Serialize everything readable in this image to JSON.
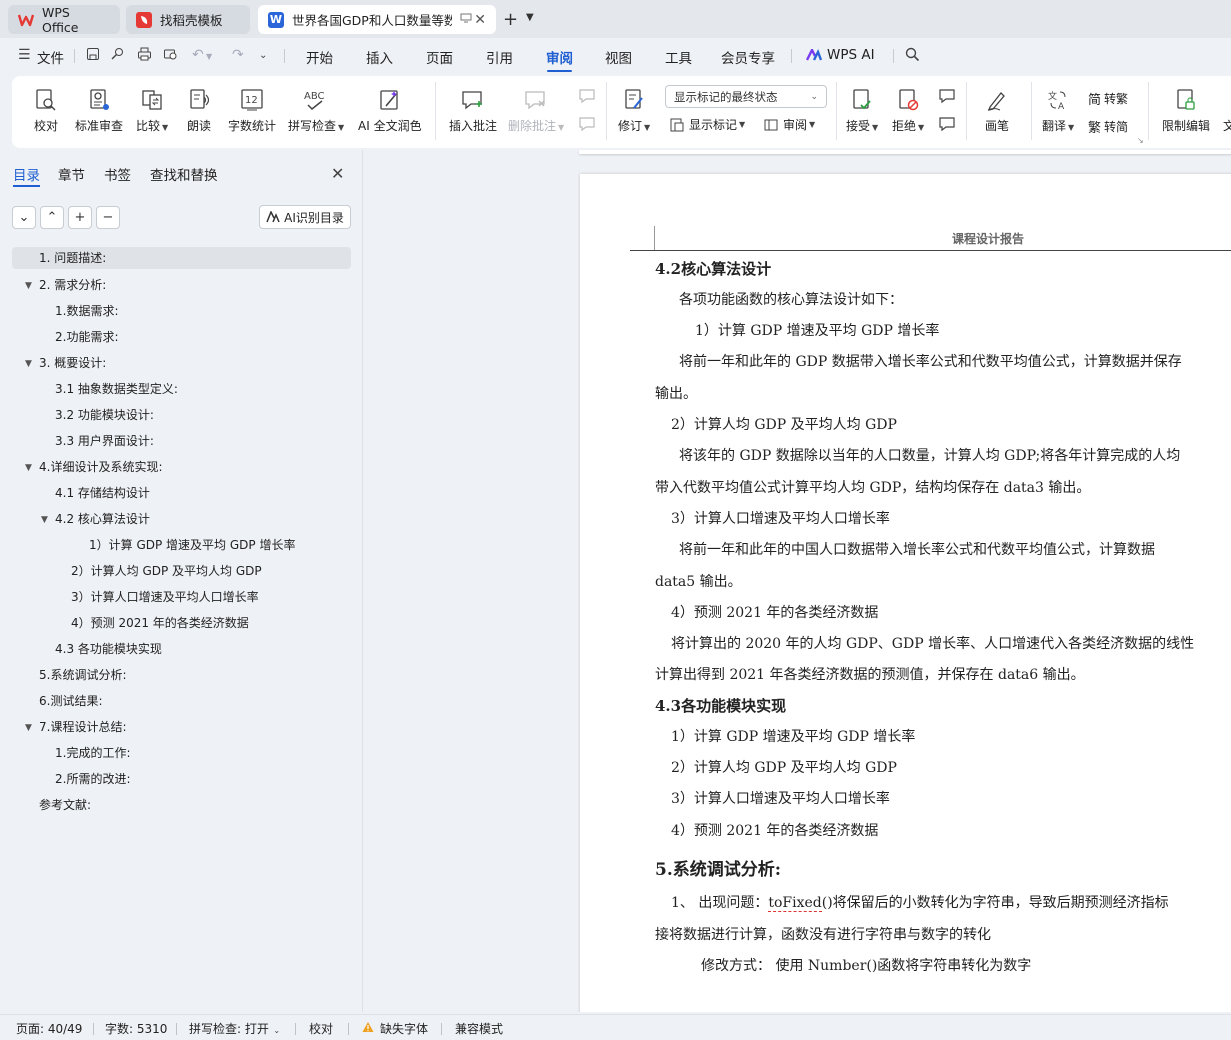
{
  "tabs": [
    {
      "label": "WPS Office"
    },
    {
      "label": "找稻壳模板"
    },
    {
      "label": "世界各国GDP和人口数量等数"
    }
  ],
  "menu": {
    "file": "文件",
    "items": [
      "开始",
      "插入",
      "页面",
      "引用",
      "审阅",
      "视图",
      "工具",
      "会员专享"
    ],
    "active": "审阅",
    "wps_ai": "WPS AI"
  },
  "ribbon": {
    "proofread": "校对",
    "std_review": "标准审查",
    "compare": "比较",
    "read_aloud": "朗读",
    "word_count": "字数统计",
    "spell_check": "拼写检查",
    "ai_polish": "AI 全文润色",
    "insert_comment": "插入批注",
    "delete_comment": "删除批注",
    "track_changes": "修订",
    "markup_select": "显示标记的最终状态",
    "show_markup": "显示标记",
    "review_pane": "审阅",
    "accept": "接受",
    "reject": "拒绝",
    "pen": "画笔",
    "translate": "翻译",
    "to_traditional": "转繁",
    "to_simplified": "转简",
    "restrict_edit": "限制编辑",
    "doc_more": "文"
  },
  "nav": {
    "tabs": [
      "目录",
      "章节",
      "书签",
      "查找和替换"
    ],
    "ai_toc": "AI识别目录",
    "toc": [
      {
        "label": "1.  问题描述:"
      },
      {
        "label": "2.  需求分析:"
      },
      {
        "label": "1.数据需求:"
      },
      {
        "label": "2.功能需求:"
      },
      {
        "label": "3.  概要设计:"
      },
      {
        "label": "3.1 抽象数据类型定义:"
      },
      {
        "label": "3.2 功能模块设计:"
      },
      {
        "label": "3.3 用户界面设计:"
      },
      {
        "label": "4.详细设计及系统实现:"
      },
      {
        "label": "4.1 存储结构设计"
      },
      {
        "label": "4.2 核心算法设计"
      },
      {
        "label": "1）计算 GDP 增速及平均 GDP 增长率"
      },
      {
        "label": "2）计算人均 GDP 及平均人均 GDP"
      },
      {
        "label": "3）计算人口增速及平均人口增长率"
      },
      {
        "label": "4）预测 2021 年的各类经济数据"
      },
      {
        "label": "4.3 各功能模块实现"
      },
      {
        "label": "5.系统调试分析:"
      },
      {
        "label": "6.测试结果:"
      },
      {
        "label": "7.课程设计总结:"
      },
      {
        "label": "1.完成的工作:"
      },
      {
        "label": "2.所需的改进:"
      },
      {
        "label": "参考文献:"
      }
    ]
  },
  "doc": {
    "header": "课程设计报告",
    "lines": [
      "4.2核心算法设计",
      "各项功能函数的核心算法设计如下：",
      "1）计算 GDP 增速及平均 GDP 增长率",
      "将前一年和此年的 GDP 数据带入增长率公式和代数平均值公式，计算数据并保存",
      "输出。",
      "2）计算人均 GDP 及平均人均 GDP",
      "将该年的 GDP 数据除以当年的人口数量，计算人均 GDP;将各年计算完成的人均",
      "带入代数平均值公式计算平均人均 GDP，结构均保存在 data3 输出。",
      "3）计算人口增速及平均人口增长率",
      "将前一年和此年的中国人口数据带入增长率公式和代数平均值公式，计算数据",
      "data5 输出。",
      "4）预测 2021 年的各类经济数据",
      "将计算出的 2020 年的人均 GDP、GDP 增长率、人口增速代入各类经济数据的线性",
      "计算出得到 2021 年各类经济数据的预测值，并保存在 data6 输出。",
      "4.3各功能模块实现",
      "1）计算 GDP 增速及平均 GDP 增长率",
      "2）计算人均 GDP 及平均人均 GDP",
      "3）计算人口增速及平均人口增长率",
      "4）预测 2021 年的各类经济数据",
      "5.系统调试分析:",
      "1、 出现问题：",
      "toFixed",
      "()将保留后的小数转化为字符串，导致后期预测经济指标",
      "接将数据进行计算，函数没有进行字符串与数字的转化",
      "修改方式：  使用 Number()函数将字符串转化为数字"
    ]
  },
  "status": {
    "page": "页面: 40/49",
    "words": "字数: 5310",
    "spell": "拼写检查: 打开",
    "proof": "校对",
    "missing_font": "缺失字体",
    "compat": "兼容模式"
  },
  "colors": {
    "accent": "#1f5fd1",
    "wps_red": "#e53935",
    "writer_blue": "#2b66d9",
    "warning": "#f0a020"
  }
}
